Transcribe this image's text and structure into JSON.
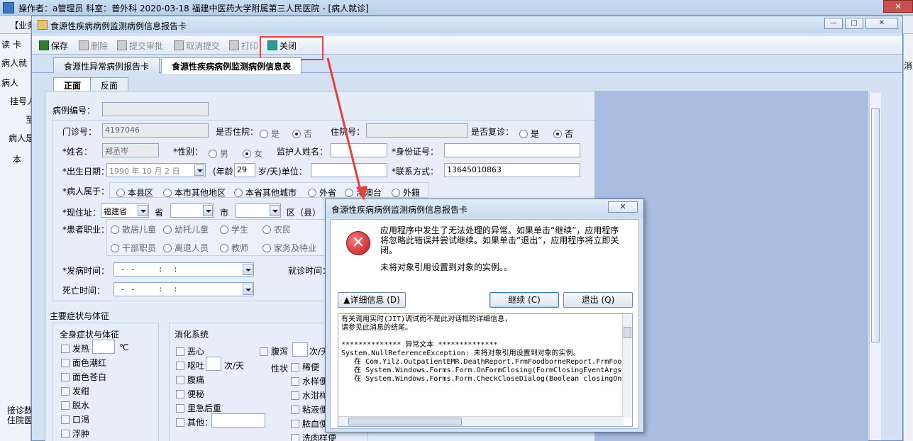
{
  "app": {
    "title": "操作者：a管理员  科室：普外科  2020-03-18  福建中医药大学附属第三人民医院 - [病人就诊]",
    "menu_first": "【业务",
    "left_items": [
      "读 卡",
      "病人就",
      "病人",
      "挂号人",
      "至",
      "病人是",
      "本",
      "接诊数",
      "住院医"
    ],
    "right_edge_text": "消费"
  },
  "window": {
    "title": "食源性疾病病例监测病例信息报告卡",
    "min": "—",
    "max": "□",
    "close": "✕"
  },
  "toolbar": {
    "save": "保存",
    "delete": "删除",
    "submit": "提交审批",
    "cancel_submit": "取消提交",
    "print": "打印",
    "close": "关闭"
  },
  "tabs": [
    "食源性异常病例报告卡",
    "食源性疾病病例监测病例信息表"
  ],
  "subtabs": [
    "正面",
    "反面"
  ],
  "form": {
    "case_no_label": "病例编号：",
    "clinic_no_label": "门诊号：",
    "clinic_no": "4197046",
    "inpatient_label": "是否住院：",
    "yes": "是",
    "no": "否",
    "admission_no_label": "住院号：",
    "revisit_label": "是否复诊：",
    "name_label": "*姓名：",
    "name": "郑丞岑",
    "gender_label": "*性别：",
    "male": "男",
    "female": "女",
    "guardian_label": "监护人姓名：",
    "id_label": "*身份证号：",
    "birth_label": "*出生日期：",
    "birth": "1990 年 10 月 2 日",
    "age_label": "(年龄",
    "age": "29",
    "age_unit": "岁/天)单位：",
    "contact_label": "*联系方式：",
    "contact": "13645010863",
    "belong_label": "*病人属于：",
    "belong_options": [
      "本县区",
      "本市其他地区",
      "本省其他城市",
      "外省",
      "港澳台",
      "外籍"
    ],
    "address_label": "*现住址：",
    "province": "福建省",
    "province_unit": "省",
    "city_unit": "市",
    "county_unit": "区（县）",
    "occupation_label": "*患者职业：",
    "occupations": [
      "散居儿童",
      "幼托儿童",
      "学生",
      "农民",
      "干部职员",
      "离退人员",
      "教师",
      "家务及待业"
    ],
    "onset_label": "*发病时间：",
    "onset_value": "  -   -          :     :",
    "visit_time_label": "就诊时间：",
    "death_label": "死亡时间：",
    "death_value": "  -   -          :     :",
    "symptoms_title": "主要症状与体征",
    "general_title": "全身症状与体征",
    "general": [
      "发热",
      "面色潮红",
      "面色苍白",
      "发绀",
      "脱水",
      "口渴",
      "浮肿"
    ],
    "fever_unit": "℃",
    "digest_title": "消化系统",
    "digest": [
      "恶心",
      "呕吐",
      "腹痛",
      "便秘",
      "里急后重",
      "其他："
    ],
    "vomit_unit": "次/天",
    "diarrhea": "腹泻",
    "diarrhea_unit": "次/天",
    "stool_label": "性状",
    "stool": [
      "稀便",
      "水样便",
      "水泔样",
      "粘液便",
      "脓血便",
      "洗肉样便"
    ]
  },
  "dialog": {
    "title": "食源性疾病病例监测病例信息报告卡",
    "message": "应用程序中发生了无法处理的异常。如果单击“继续”，应用程序将忽略此错误并尝试继续。如果单击“退出”，应用程序将立即关闭。",
    "message2": "未将对象引用设置到对象的实例。。",
    "details_btn": "▲详细信息 (D)",
    "continue_btn": "继续 (C)",
    "exit_btn": "退出 (Q)",
    "details_text": "有关调用实时(JIT)调试而不是此对话框的详细信息，\n请参见此消息的结尾。\n\n************** 异常文本 **************\nSystem.NullReferenceException: 未将对象引用设置到对象的实例。\n   在 Com.Yilz.OutpatientEMR.DeathReport.FrmFoodborneReport.FrmFoo\n   在 System.Windows.Forms.Form.OnFormClosing(FormClosingEventArgs\n   在 System.Windows.Forms.Form.CheckCloseDialog(Boolean closingOn"
  },
  "colors": {
    "highlight": "#e8403b",
    "error_icon": "#c4161c"
  }
}
